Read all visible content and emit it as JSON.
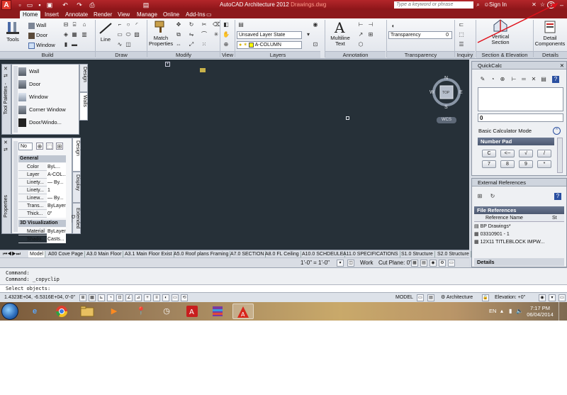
{
  "window": {
    "app_title": "AutoCAD Architecture 2012",
    "file_name": "Drawings.dwg",
    "search_placeholder": "Type a keyword or phrase",
    "sign_in": "Sign In"
  },
  "ribbon_tabs": [
    "Home",
    "Insert",
    "Annotate",
    "Render",
    "View",
    "Manage",
    "Online",
    "Add-Ins"
  ],
  "ribbon": {
    "panels": {
      "build": "Build",
      "draw": "Draw",
      "modify": "Modify",
      "view": "View",
      "layers": "Layers",
      "annotation": "Annotation",
      "transparency": "Transparency",
      "inquiry": "Inquiry",
      "section": "Section & Elevation",
      "details": "Details"
    },
    "tools_label": "Tools",
    "wall": "Wall",
    "door": "Door",
    "window": "Window",
    "line": "Line",
    "match_properties_1": "Match",
    "match_properties_2": "Properties",
    "layer_state": "Unsaved Layer State",
    "current_layer": "A-COLUMN",
    "multiline_1": "Multiline",
    "multiline_2": "Text",
    "transparency_label": "Transparency",
    "transparency_value": "0",
    "vertical_section_1": "Vertical",
    "vertical_section_2": "Section",
    "detail_1": "Detail",
    "detail_2": "Components"
  },
  "viewcube": {
    "n": "N",
    "s": "S",
    "e": "E",
    "w": "W",
    "top": "TOP",
    "wcs": "WCS"
  },
  "tool_palettes": {
    "strip_label": "Tool Palettes - ",
    "tabs": [
      "Design",
      "Walls"
    ],
    "items": [
      "Wall",
      "Door",
      "Window",
      "Corner Window",
      "Door/Windo..."
    ]
  },
  "properties": {
    "strip_label": "Properties",
    "selector": "No",
    "tabs": [
      "Design",
      "Display",
      "Extended D..."
    ],
    "general_header": "General",
    "rows": [
      {
        "k": "Color",
        "v": "ByL..."
      },
      {
        "k": "Layer",
        "v": "A-COL..."
      },
      {
        "k": "Linety...",
        "v": "— By..."
      },
      {
        "k": "Linety...",
        "v": "1"
      },
      {
        "k": "Linew...",
        "v": "— By..."
      },
      {
        "k": "Trans...",
        "v": "ByLayer"
      },
      {
        "k": "Thick...",
        "v": "0\""
      }
    ],
    "viz_header": "3D Visualization",
    "viz_rows": [
      {
        "k": "Material",
        "v": "ByLayer"
      },
      {
        "k": "Shado...",
        "v": "Casts..."
      }
    ]
  },
  "layout_tabs": [
    "Model",
    "A00 Cove Page",
    "A3.0 Main Floor",
    "A3.1 Main Floor Exist",
    "A5.0 Roof plans Framing",
    "A7.0 SECTION",
    "A8.0 FL Ceiling",
    "A10.0 SCHDEULE",
    "A11.0 SPECIFICATIONS",
    "S1.0 Structure",
    "S2.0 Structure"
  ],
  "layout_bar": {
    "scale": "1'-0\" = 1'-0\"",
    "workspace": "Work",
    "cut_plane": "Cut Plane: 0\""
  },
  "command": {
    "lines": [
      "Command:",
      "Command:  _copyclip",
      "Select objects:"
    ]
  },
  "status_bar": {
    "coordinates": "1.4323E+04, -6.5316E+04, 0'-0\"",
    "model": "MODEL",
    "architecture": "Architecture",
    "elevation": "Elevation: +0\""
  },
  "quickcalc": {
    "title": "QuickCalc",
    "display_value": "0",
    "mode": "Basic Calculator Mode",
    "number_pad": "Number Pad",
    "keys_row1": [
      "C",
      "<--",
      "√",
      "/"
    ],
    "keys_row2": [
      "7",
      "8",
      "9",
      "*"
    ]
  },
  "external_references": {
    "title": "External References",
    "file_references": "File References",
    "col_name": "Reference Name",
    "col_status": "St",
    "items": [
      "BP Drawings*",
      "03310901 - 1",
      "12X11 TITLEBLOCK IMPW..."
    ],
    "details": "Details"
  },
  "taskbar": {
    "lang": "EN",
    "time": "7:17 PM",
    "date": "06/04/2014"
  },
  "colors": {
    "title_red": "#8c1519",
    "canvas": "#263038",
    "accent": "#e23a2f"
  }
}
